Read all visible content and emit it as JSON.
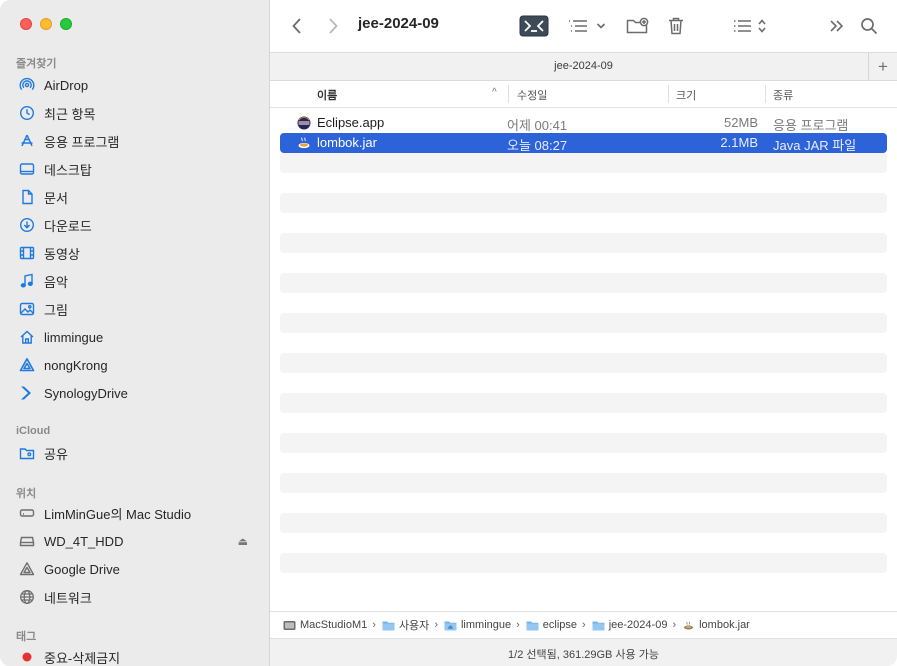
{
  "window": {
    "title": "jee-2024-09"
  },
  "sidebar": {
    "favorites_label": "즐겨찾기",
    "favorites": [
      {
        "label": "AirDrop",
        "icon": "airdrop-icon"
      },
      {
        "label": "최근 항목",
        "icon": "clock-icon"
      },
      {
        "label": "응용 프로그램",
        "icon": "applications-icon"
      },
      {
        "label": "데스크탑",
        "icon": "desktop-icon"
      },
      {
        "label": "문서",
        "icon": "document-icon"
      },
      {
        "label": "다운로드",
        "icon": "download-icon"
      },
      {
        "label": "동영상",
        "icon": "movie-icon"
      },
      {
        "label": "음악",
        "icon": "music-icon"
      },
      {
        "label": "그림",
        "icon": "picture-icon"
      },
      {
        "label": "limmingue",
        "icon": "home-icon"
      },
      {
        "label": "nongKrong",
        "icon": "drive-triangle-icon"
      },
      {
        "label": "SynologyDrive",
        "icon": "synology-icon"
      }
    ],
    "icloud_label": "iCloud",
    "icloud": [
      {
        "label": "공유",
        "icon": "shared-folder-icon"
      }
    ],
    "locations_label": "위치",
    "locations": [
      {
        "label": "LimMinGue의 Mac Studio",
        "icon": "computer-icon"
      },
      {
        "label": "WD_4T_HDD",
        "icon": "disk-icon",
        "eject": "⏏"
      },
      {
        "label": "Google Drive",
        "icon": "google-drive-icon"
      },
      {
        "label": "네트워크",
        "icon": "network-icon"
      }
    ],
    "tags_label": "태그",
    "tags": [
      {
        "label": "중요-삭제금지",
        "color": "#e5322d"
      }
    ]
  },
  "tab": {
    "label": "jee-2024-09",
    "add": "+"
  },
  "columns": {
    "name": "이름",
    "date": "수정일",
    "size": "크기",
    "kind": "종류",
    "sort_indicator": "^"
  },
  "files": [
    {
      "name": "Eclipse.app",
      "date": "어제 00:41",
      "size": "52MB",
      "kind": "응용 프로그램",
      "selected": false,
      "icon": "eclipse-icon"
    },
    {
      "name": "lombok.jar",
      "date": "오늘 08:27",
      "size": "2.1MB",
      "kind": "Java JAR 파일",
      "selected": true,
      "icon": "java-jar-icon"
    }
  ],
  "pathbar": [
    {
      "label": "MacStudioM1",
      "icon": "computer-icon"
    },
    {
      "label": "사용자",
      "icon": "folder-icon"
    },
    {
      "label": "limmingue",
      "icon": "home-folder-icon"
    },
    {
      "label": "eclipse",
      "icon": "folder-icon"
    },
    {
      "label": "jee-2024-09",
      "icon": "folder-icon"
    },
    {
      "label": "lombok.jar",
      "icon": "java-jar-icon"
    }
  ],
  "status": {
    "text": "1/2 선택됨, 361.29GB 사용 가능"
  },
  "colors": {
    "accent": "#2d63d8",
    "sidebar_icon": "#1f7ae0"
  }
}
